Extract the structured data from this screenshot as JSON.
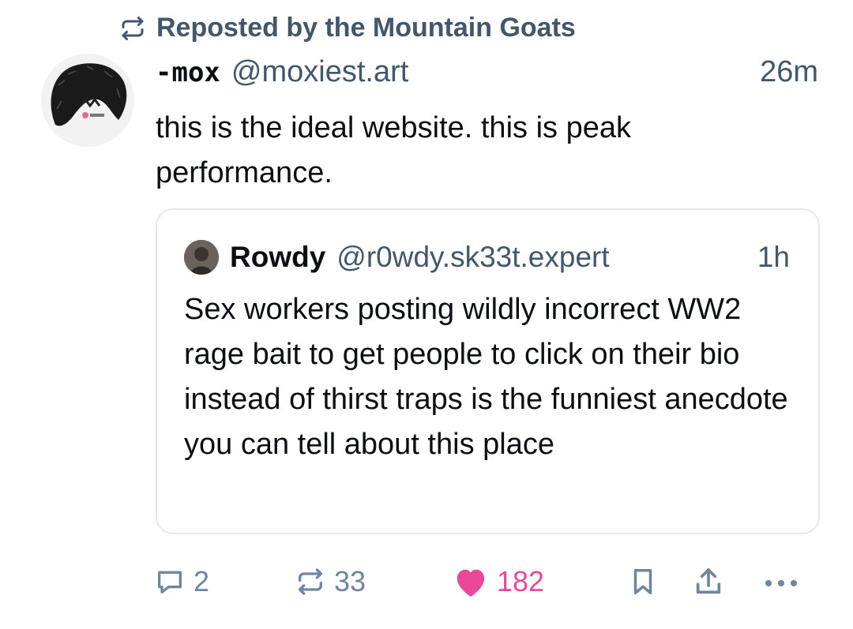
{
  "repost_banner": {
    "text": "Reposted by the Mountain Goats",
    "icon": "repost-icon"
  },
  "post": {
    "avatar_icon": "avatar",
    "display_name": "-mox",
    "handle": "@moxiest.art",
    "time": "26m",
    "text": "this is the ideal website. this is peak performance."
  },
  "quote": {
    "avatar_icon": "avatar",
    "display_name": "Rowdy",
    "handle": "@r0wdy.sk33t.expert",
    "time": "1h",
    "text": "Sex workers posting wildly incorrect WW2 rage bait to get people to click on their bio instead of thirst traps is the funniest anecdote you can tell about this place"
  },
  "actions": {
    "reply_count": "2",
    "repost_count": "33",
    "like_count": "182",
    "like_color": "#ec4899",
    "muted_color": "#6f869f"
  }
}
